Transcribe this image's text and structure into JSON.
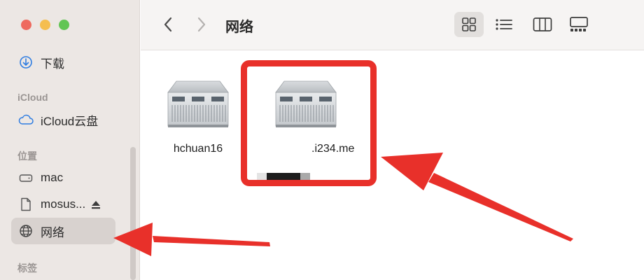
{
  "window": {
    "title": "网络"
  },
  "sidebar": {
    "items": [
      {
        "label": "下载",
        "icon": "download-circle-icon"
      },
      {
        "label": "iCloud云盘",
        "icon": "icloud-icon"
      },
      {
        "label": "mac",
        "icon": "drive-icon"
      },
      {
        "label": "mosus...",
        "icon": "document-icon"
      },
      {
        "label": "网络",
        "icon": "globe-icon",
        "selected": true
      }
    ],
    "sections": {
      "icloud": "iCloud",
      "locations": "位置",
      "tags": "标签"
    }
  },
  "toolbar": {
    "title": "网络",
    "views": [
      "icon-view",
      "list-view",
      "column-view",
      "gallery-view"
    ],
    "active_view": "icon-view"
  },
  "content": {
    "items": [
      {
        "name": "hchuan16",
        "icon": "server-icon"
      },
      {
        "name": ".i234.me",
        "icon": "server-icon",
        "name_partially_redacted": true
      }
    ]
  },
  "colors": {
    "sidebar_bg": "#ece7e4",
    "selected_bg": "#d8d2cf",
    "annotation_red": "#e8302a",
    "close": "#ee6a5f",
    "minimize": "#f5be4f",
    "maximize": "#62c554"
  }
}
